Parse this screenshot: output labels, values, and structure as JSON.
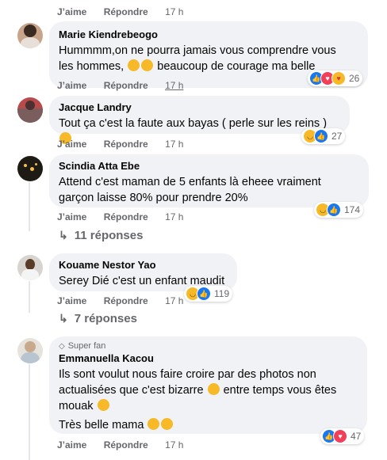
{
  "top_actions": {
    "like": "J’aime",
    "reply": "Répondre",
    "time": "17 h"
  },
  "comments": [
    {
      "author": "Marie Kiendrebeogo",
      "text_line1": "Hummmm,on ne pourra jamais vous comprendre vous",
      "text_line2": "les hommes,",
      "text_line2b": "beaucoup de courage ma belle",
      "like": "J’aime",
      "reply": "Répondre",
      "time": "17 h",
      "reactions": [
        "like",
        "love",
        "care"
      ],
      "reaction_count": "26"
    },
    {
      "author": "Jacque Landry",
      "text_line1": "Tout ça c'est la faute aux bayas ( perle sur les reins )",
      "like": "J’aime",
      "reply": "Répondre",
      "time": "17 h",
      "reactions": [
        "haha",
        "like"
      ],
      "reaction_count": "27"
    },
    {
      "author": "Scindia Atta Ebe",
      "text_line1": "Attend c'est maman de 5 enfants là eheee vraiment",
      "text_line2": "garçon laisse 80% pour prendre 20%",
      "like": "J’aime",
      "reply": "Répondre",
      "time": "17 h",
      "reactions": [
        "haha",
        "like"
      ],
      "reaction_count": "174",
      "replies_label": "11 réponses"
    },
    {
      "author": "Kouame Nestor Yao",
      "text_line1": "Serey Dié c'est un enfant maudit",
      "like": "J’aime",
      "reply": "Répondre",
      "time": "17 h",
      "reactions": [
        "haha",
        "like"
      ],
      "reaction_count": "119",
      "replies_label": "7 réponses"
    },
    {
      "badge": "Super fan",
      "author": "Emmanuella Kacou",
      "text_line1": "Ils sont voulut nous faire croire par des photos non",
      "text_line2a": "actualisées que c'est bizarre",
      "text_line2b": "entre temps vous êtes",
      "text_line3": "mouak",
      "text_line4": "Très belle mama",
      "like": "J’aime",
      "reply": "Répondre",
      "time": "17 h",
      "reactions": [
        "like",
        "love"
      ],
      "reaction_count": "47"
    }
  ],
  "colors": {
    "bubble": "#f0f2f5",
    "meta": "#65676b",
    "like": "#1877f2",
    "love": "#f33e58",
    "haha": "#f7b928"
  }
}
